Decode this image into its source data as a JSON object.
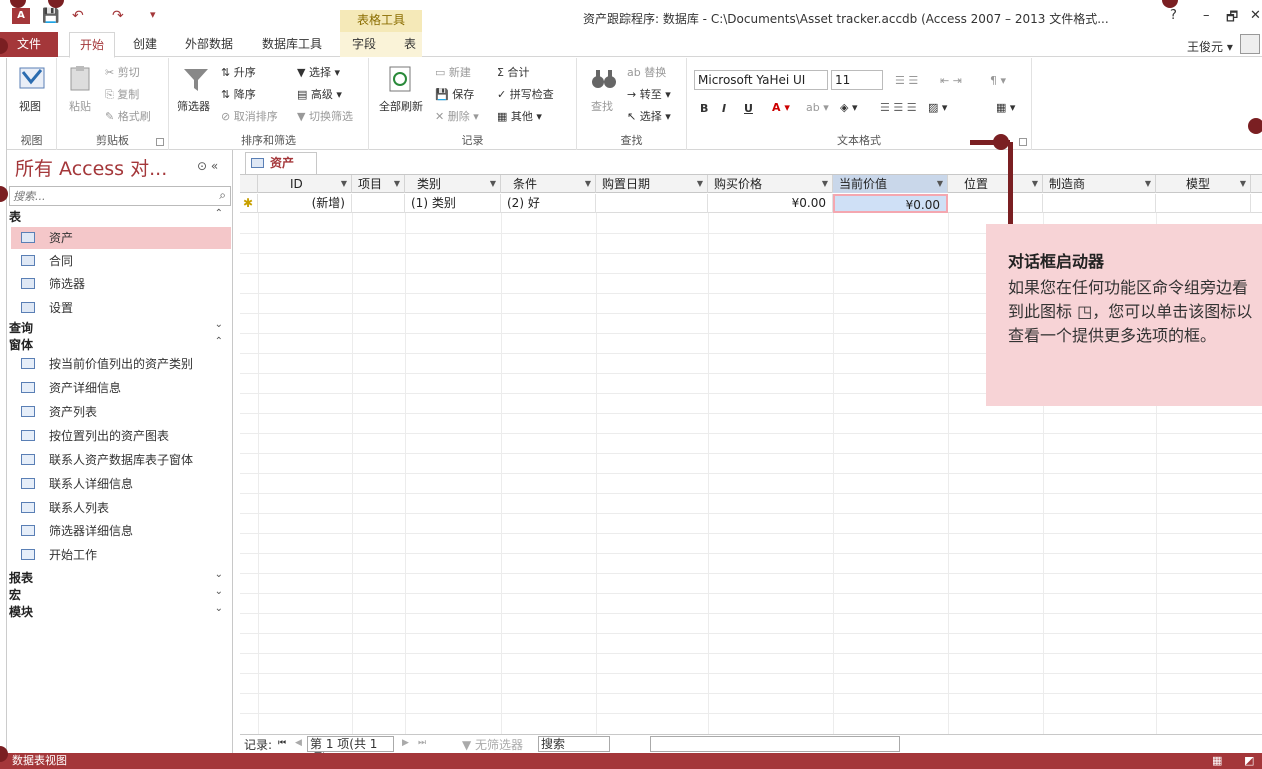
{
  "window": {
    "app_icon": "A",
    "contextual_group": "表格工具",
    "title": "资产跟踪程序: 数据库 - C:\\Documents\\Asset tracker.accdb (Access 2007 – 2013 文件格式...",
    "help": "?",
    "minimize": "–",
    "restore": "🗗",
    "close": "✕"
  },
  "tabs": {
    "file": "文件",
    "home": "开始",
    "create": "创建",
    "external": "外部数据",
    "dbtools": "数据库工具",
    "fields": "字段",
    "table": "表",
    "user": "王俊元 ▾"
  },
  "ribbon": {
    "views": {
      "view": "视图",
      "label": "视图"
    },
    "clipboard": {
      "paste": "粘贴",
      "cut": "剪切",
      "copy": "复制",
      "painter": "格式刷",
      "label": "剪贴板"
    },
    "sort": {
      "filter": "筛选器",
      "asc": "升序",
      "desc": "降序",
      "clear": "取消排序",
      "selection": "选择 ▾",
      "advanced": "高级 ▾",
      "toggle": "切换筛选",
      "label": "排序和筛选"
    },
    "records": {
      "refresh": "全部刷新",
      "new": "新建",
      "save": "保存",
      "delete": "删除 ▾",
      "totals": "合计",
      "spelling": "拼写检查",
      "more": "其他 ▾",
      "label": "记录"
    },
    "find": {
      "find": "查找",
      "replace": "替换",
      "goto": "转至 ▾",
      "select": "选择 ▾",
      "label": "查找"
    },
    "text": {
      "font": "Microsoft YaHei UI",
      "size": "11",
      "bold": "B",
      "italic": "I",
      "underline": "U",
      "label": "文本格式"
    }
  },
  "nav": {
    "title": "所有 Access 对...",
    "search_placeholder": "搜索...",
    "sections": {
      "tables": "表",
      "queries": "查询",
      "forms": "窗体",
      "reports": "报表",
      "macros": "宏",
      "modules": "模块"
    },
    "tables": [
      "资产",
      "合同",
      "筛选器",
      "设置"
    ],
    "forms": [
      "按当前价值列出的资产类别",
      "资产详细信息",
      "资产列表",
      "按位置列出的资产图表",
      "联系人资产数据库表子窗体",
      "联系人详细信息",
      "联系人列表",
      "筛选器详细信息",
      "开始工作"
    ]
  },
  "document": {
    "tab": "资产",
    "columns": [
      "ID",
      "项目",
      "类别",
      "条件",
      "购置日期",
      "购买价格",
      "当前价值",
      "位置",
      "制造商",
      "模型"
    ],
    "new_row": {
      "marker": "✱",
      "id": "(新增)",
      "category": "(1) 类别",
      "condition": "(2) 好",
      "price": "¥0.00",
      "value": "¥0.00"
    }
  },
  "recordbar": {
    "label": "记录:",
    "first": "⏮",
    "prev": "◀",
    "position": "第 1 项(共 1 项)",
    "next": "▶",
    "last": "⏭",
    "nofilter": "无筛选器",
    "search": "搜索"
  },
  "callout": {
    "title": "对话框启动器",
    "body": "如果您在任何功能区命令组旁边看到此图标 ◳，您可以单击该图标以查看一个提供更多选项的框。"
  },
  "status": {
    "text": "数据表视图"
  },
  "colors": {
    "accent": "#a4373a",
    "callout_bg": "#f7d3d6",
    "pointer": "#7a1f22"
  }
}
